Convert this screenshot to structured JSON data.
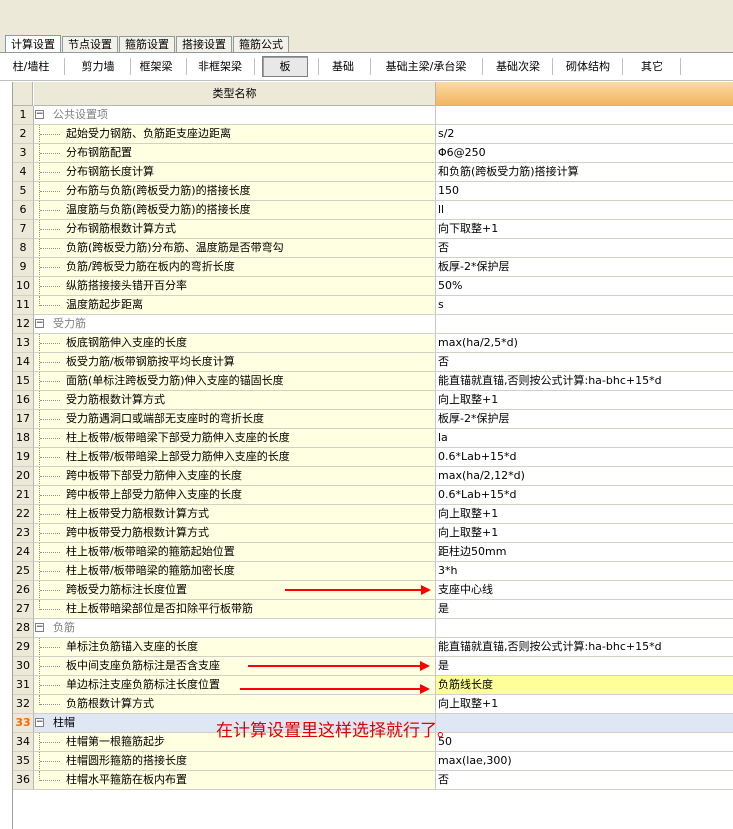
{
  "main_tabs": [
    {
      "label": "计算设置",
      "active": true
    },
    {
      "label": "节点设置",
      "active": false
    },
    {
      "label": "箍筋设置",
      "active": false
    },
    {
      "label": "搭接设置",
      "active": false
    },
    {
      "label": "箍筋公式",
      "active": false
    }
  ],
  "sub_tabs": [
    {
      "label": "柱/墙柱",
      "active": false
    },
    {
      "label": "剪力墙",
      "active": false
    },
    {
      "label": "框架梁",
      "active": false
    },
    {
      "label": "非框架梁",
      "active": false
    },
    {
      "label": "板",
      "active": true
    },
    {
      "label": "基础",
      "active": false
    },
    {
      "label": "基础主梁/承台梁",
      "active": false
    },
    {
      "label": "基础次梁",
      "active": false
    },
    {
      "label": "砌体结构",
      "active": false
    },
    {
      "label": "其它",
      "active": false
    }
  ],
  "grid": {
    "header_name": "类型名称",
    "rows": [
      {
        "num": "1",
        "name": "公共设置项",
        "value": "",
        "category": true
      },
      {
        "num": "2",
        "name": "起始受力钢筋、负筋距支座边距离",
        "value": "s/2"
      },
      {
        "num": "3",
        "name": "分布钢筋配置",
        "value": "Φ6@250"
      },
      {
        "num": "4",
        "name": "分布钢筋长度计算",
        "value": "和负筋(跨板受力筋)搭接计算"
      },
      {
        "num": "5",
        "name": "分布筋与负筋(跨板受力筋)的搭接长度",
        "value": "150"
      },
      {
        "num": "6",
        "name": "温度筋与负筋(跨板受力筋)的搭接长度",
        "value": "ll"
      },
      {
        "num": "7",
        "name": "分布钢筋根数计算方式",
        "value": "向下取整+1"
      },
      {
        "num": "8",
        "name": "负筋(跨板受力筋)分布筋、温度筋是否带弯勾",
        "value": "否"
      },
      {
        "num": "9",
        "name": "负筋/跨板受力筋在板内的弯折长度",
        "value": "板厚-2*保护层"
      },
      {
        "num": "10",
        "name": "纵筋搭接接头错开百分率",
        "value": "50%"
      },
      {
        "num": "11",
        "name": "温度筋起步距离",
        "value": "s"
      },
      {
        "num": "12",
        "name": "受力筋",
        "value": "",
        "category": true
      },
      {
        "num": "13",
        "name": "板底钢筋伸入支座的长度",
        "value": "max(ha/2,5*d)"
      },
      {
        "num": "14",
        "name": "板受力筋/板带钢筋按平均长度计算",
        "value": "否"
      },
      {
        "num": "15",
        "name": "面筋(单标注跨板受力筋)伸入支座的锚固长度",
        "value": "能直锚就直锚,否则按公式计算:ha-bhc+15*d"
      },
      {
        "num": "16",
        "name": "受力筋根数计算方式",
        "value": "向上取整+1"
      },
      {
        "num": "17",
        "name": "受力筋遇洞口或端部无支座时的弯折长度",
        "value": "板厚-2*保护层"
      },
      {
        "num": "18",
        "name": "柱上板带/板带暗梁下部受力筋伸入支座的长度",
        "value": "la"
      },
      {
        "num": "19",
        "name": "柱上板带/板带暗梁上部受力筋伸入支座的长度",
        "value": "0.6*Lab+15*d"
      },
      {
        "num": "20",
        "name": "跨中板带下部受力筋伸入支座的长度",
        "value": "max(ha/2,12*d)"
      },
      {
        "num": "21",
        "name": "跨中板带上部受力筋伸入支座的长度",
        "value": "0.6*Lab+15*d"
      },
      {
        "num": "22",
        "name": "柱上板带受力筋根数计算方式",
        "value": "向上取整+1"
      },
      {
        "num": "23",
        "name": "跨中板带受力筋根数计算方式",
        "value": "向上取整+1"
      },
      {
        "num": "24",
        "name": "柱上板带/板带暗梁的箍筋起始位置",
        "value": "距柱边50mm"
      },
      {
        "num": "25",
        "name": "柱上板带/板带暗梁的箍筋加密长度",
        "value": "3*h"
      },
      {
        "num": "26",
        "name": "跨板受力筋标注长度位置",
        "value": "支座中心线"
      },
      {
        "num": "27",
        "name": "柱上板带暗梁部位是否扣除平行板带筋",
        "value": "是"
      },
      {
        "num": "28",
        "name": "负筋",
        "value": "",
        "category": true
      },
      {
        "num": "29",
        "name": "单标注负筋锚入支座的长度",
        "value": "能直锚就直锚,否则按公式计算:ha-bhc+15*d"
      },
      {
        "num": "30",
        "name": "板中间支座负筋标注是否含支座",
        "value": "是"
      },
      {
        "num": "31",
        "name": "单边标注支座负筋标注长度位置",
        "value": "负筋线长度",
        "yellow": true
      },
      {
        "num": "32",
        "name": "负筋根数计算方式",
        "value": "向上取整+1"
      },
      {
        "num": "33",
        "name": "柱帽",
        "value": "",
        "category": true,
        "selected": true
      },
      {
        "num": "34",
        "name": "柱帽第一根箍筋起步",
        "value": "50"
      },
      {
        "num": "35",
        "name": "柱帽圆形箍筋的搭接长度",
        "value": "max(lae,300)"
      },
      {
        "num": "36",
        "name": "柱帽水平箍筋在板内布置",
        "value": "否"
      }
    ]
  },
  "annotation": {
    "note": "在计算设置里这样选择就行了。",
    "arrow_color": "#ff0000"
  },
  "colors": {
    "name_cell_bg": "#ffffe1",
    "header_value_bg": "#f3b560",
    "highlight_value_bg": "#ffff99",
    "selected_row_bg": "#dfe7f5"
  }
}
